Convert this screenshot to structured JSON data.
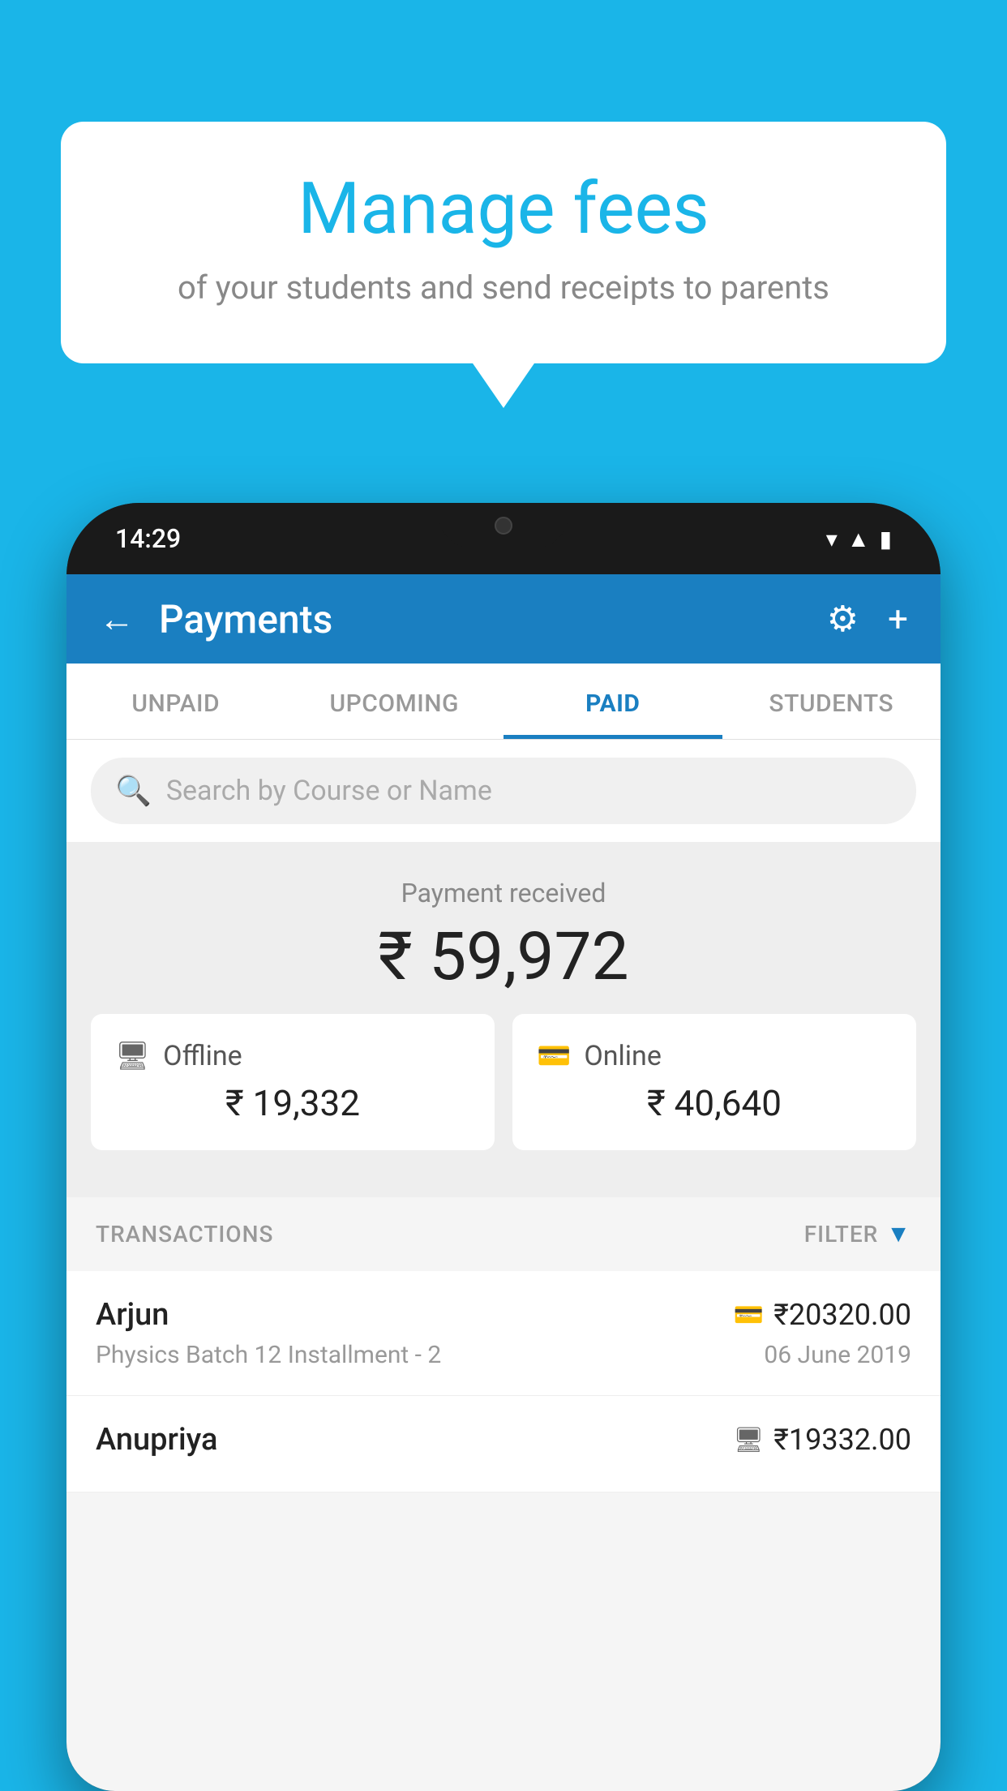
{
  "page": {
    "background_color": "#1ab5e8"
  },
  "bubble": {
    "title": "Manage fees",
    "subtitle": "of your students and send receipts to parents"
  },
  "status_bar": {
    "time": "14:29"
  },
  "header": {
    "title": "Payments",
    "back_label": "←",
    "gear_label": "⚙",
    "plus_label": "+"
  },
  "tabs": [
    {
      "label": "UNPAID",
      "active": false
    },
    {
      "label": "UPCOMING",
      "active": false
    },
    {
      "label": "PAID",
      "active": true
    },
    {
      "label": "STUDENTS",
      "active": false
    }
  ],
  "search": {
    "placeholder": "Search by Course or Name"
  },
  "payment_received": {
    "label": "Payment received",
    "amount": "₹ 59,972"
  },
  "cards": {
    "offline": {
      "label": "Offline",
      "amount": "₹ 19,332"
    },
    "online": {
      "label": "Online",
      "amount": "₹ 40,640"
    }
  },
  "transactions": {
    "section_label": "TRANSACTIONS",
    "filter_label": "FILTER",
    "items": [
      {
        "name": "Arjun",
        "description": "Physics Batch 12 Installment - 2",
        "amount": "₹20320.00",
        "date": "06 June 2019",
        "type": "online"
      },
      {
        "name": "Anupriya",
        "description": "",
        "amount": "₹19332.00",
        "date": "",
        "type": "offline"
      }
    ]
  }
}
